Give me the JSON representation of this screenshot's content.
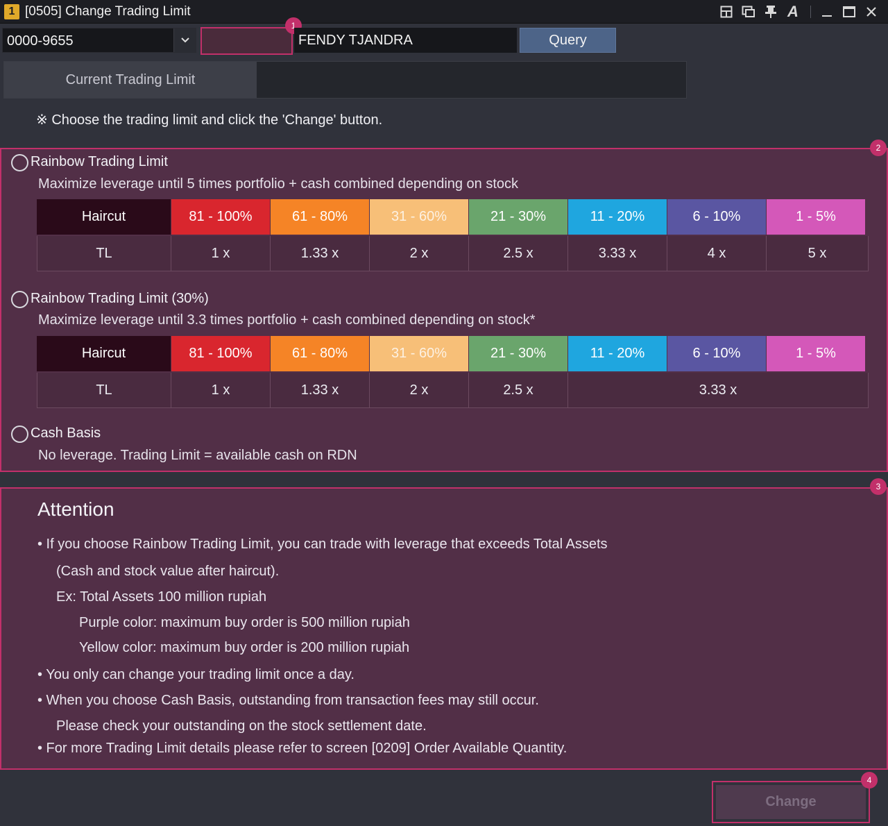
{
  "window": {
    "icon_label": "1",
    "title": "[0505] Change Trading Limit",
    "controls": [
      "layout-icon",
      "popout-icon",
      "pin-icon",
      "font-icon",
      "minimize-icon",
      "maximize-icon",
      "close-icon"
    ]
  },
  "query": {
    "account": "0000-9655",
    "password": "",
    "name": "FENDY TJANDRA",
    "query_label": "Query"
  },
  "tabs": [
    {
      "label": "Current Trading Limit"
    }
  ],
  "instruction": "※ Choose the trading limit and click the 'Change' button.",
  "colors": {
    "accent": "#c2306a",
    "panel": "#522f47",
    "haircut_header": "#2a0a19",
    "h81_100": "#d9262e",
    "h61_80": "#f58426",
    "h31_60": "#f7bf78",
    "h21_30": "#6aa56c",
    "h11_20": "#1fa6df",
    "h6_10": "#5a56a2",
    "h1_5": "#d458b9"
  },
  "options": [
    {
      "title": "Rainbow Trading Limit",
      "desc": "Maximize leverage until 5 times portfolio + cash combined depending on stock",
      "selected": false,
      "table": {
        "haircut_label": "Haircut",
        "tl_label": "TL",
        "haircuts": [
          "81 - 100%",
          "61 - 80%",
          "31 - 60%",
          "21 - 30%",
          "11 - 20%",
          "6 - 10%",
          "1 - 5%"
        ],
        "tl": [
          "1 x",
          "1.33 x",
          "2 x",
          "2.5 x",
          "3.33 x",
          "4 x",
          "5 x"
        ]
      }
    },
    {
      "title": "Rainbow Trading Limit (30%)",
      "desc": "Maximize leverage until 3.3 times portfolio + cash combined depending on stock*",
      "selected": false,
      "table": {
        "haircut_label": "Haircut",
        "tl_label": "TL",
        "haircuts": [
          "81 - 100%",
          "61 - 80%",
          "31 - 60%",
          "21 - 30%",
          "11 - 20%",
          "6 - 10%",
          "1 - 5%"
        ],
        "tl": [
          "1 x",
          "1.33 x",
          "2 x",
          "2.5 x",
          "3.33 x"
        ]
      }
    },
    {
      "title": "Cash Basis",
      "desc": "No leverage. Trading Limit = available cash on RDN",
      "selected": false
    }
  ],
  "attention": {
    "title": "Attention",
    "lines": [
      "• If you choose Rainbow Trading Limit, you can trade with leverage that exceeds Total Assets",
      "(Cash and stock value after haircut).",
      "Ex: Total Assets 100 million rupiah",
      "Purple color: maximum buy order is 500 million rupiah",
      "Yellow color: maximum buy order is 200 million rupiah",
      "• You only can change your trading limit once a day.",
      "• When you choose Cash Basis, outstanding from transaction fees may still occur.",
      "Please check your outstanding on the stock settlement date.",
      "• For more Trading Limit details please refer to screen [0209] Order Available Quantity."
    ]
  },
  "change_label": "Change",
  "badges": [
    "1",
    "2",
    "3",
    "4"
  ]
}
